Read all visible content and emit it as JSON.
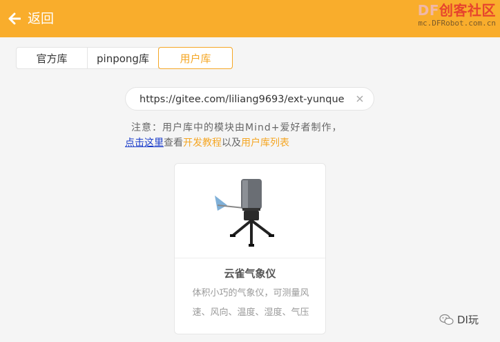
{
  "header": {
    "back_label": "返回",
    "logo_prefix": "DF",
    "logo_text": "创客社区",
    "logo_url": "mc.DFRobot.com.cn"
  },
  "tabs": [
    {
      "label": "官方库",
      "active": false
    },
    {
      "label": "pinpong库",
      "active": false
    },
    {
      "label": "用户库",
      "active": true
    }
  ],
  "url_input": {
    "value": "https://gitee.com/liliang9693/ext-yunque"
  },
  "notice": {
    "line1": "注意：用户库中的模块由Mind+爱好者制作，",
    "link_click_here": "点击这里",
    "view_text": "查看",
    "dev_tutorial": "开发教程",
    "and_text": "以及",
    "user_lib_list": "用户库列表"
  },
  "card": {
    "title": "云雀气象仪",
    "description": "体积小巧的气象仪，可测量风速、风向、温度、湿度、气压"
  },
  "watermark": {
    "text": "DI玩",
    "icon": "wechat-icon"
  },
  "colors": {
    "header_bg": "#f9ad2c",
    "accent": "#f5a623",
    "link": "#1a3cc9"
  }
}
